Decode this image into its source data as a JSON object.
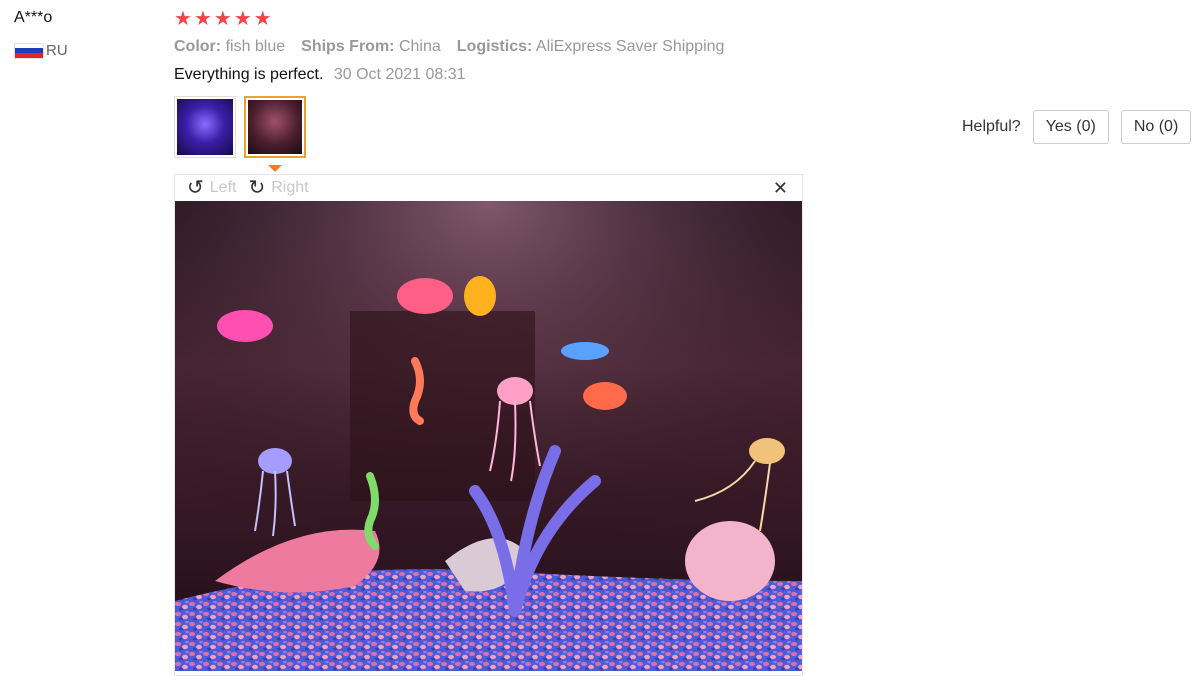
{
  "user": {
    "name": "A***o",
    "country_code": "RU",
    "flag_icon": "russia-flag-icon",
    "flag_colors": [
      "#ffffff",
      "#1c3fb8",
      "#e3242b"
    ]
  },
  "review": {
    "rating": 5,
    "star_color": "#f2454b",
    "attributes": [
      {
        "key": "Color:",
        "value": "fish blue"
      },
      {
        "key": "Ships From:",
        "value": "China"
      },
      {
        "key": "Logistics:",
        "value": "AliExpress Saver Shipping"
      }
    ],
    "text": "Everything is perfect.",
    "date": "30 Oct 2021 08:31"
  },
  "viewer": {
    "rotate_left_label": "Left",
    "rotate_right_label": "Right",
    "close_icon": "close-icon"
  },
  "helpful": {
    "label": "Helpful?",
    "yes_label": "Yes (0)",
    "no_label": "No (0)"
  }
}
